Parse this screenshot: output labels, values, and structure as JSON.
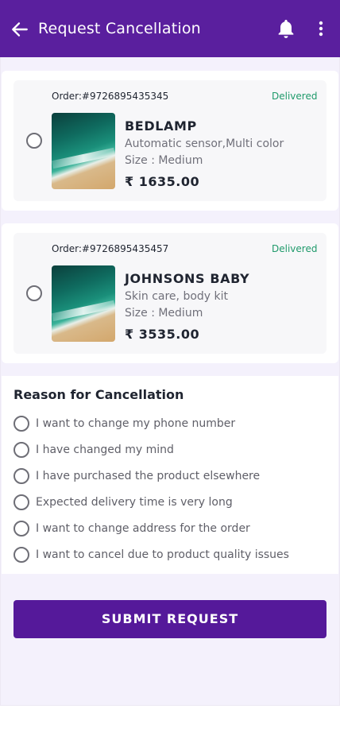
{
  "header": {
    "title": "Request Cancellation",
    "back_icon": "arrow-left-icon",
    "notification_icon": "bell-icon",
    "menu_icon": "more-vertical-icon",
    "color": "#5a1f9e"
  },
  "orders": [
    {
      "order_no": "Order:#9726895435345",
      "status": "Delivered",
      "name": "BEDLAMP",
      "description": "Automatic sensor,Multi color",
      "size": "Size : Medium",
      "price": "₹ 1635.00",
      "selected": false
    },
    {
      "order_no": "Order:#9726895435457",
      "status": "Delivered",
      "name": "JOHNSONS BABY",
      "description": "Skin care, body kit",
      "size": "Size : Medium",
      "price": "₹ 3535.00",
      "selected": false
    }
  ],
  "reasons": {
    "heading": "Reason for Cancellation",
    "options": [
      "I want to change my phone number",
      "I have changed my mind",
      "I have purchased the product elsewhere",
      "Expected delivery time is very long",
      "I want to change address for the order",
      "I want to cancel due to product quality issues"
    ]
  },
  "submit": {
    "label": "SUBMIT REQUEST",
    "color": "#55199a"
  },
  "colors": {
    "status_delivered": "#1f9a6b",
    "background": "#f4f1fc"
  }
}
